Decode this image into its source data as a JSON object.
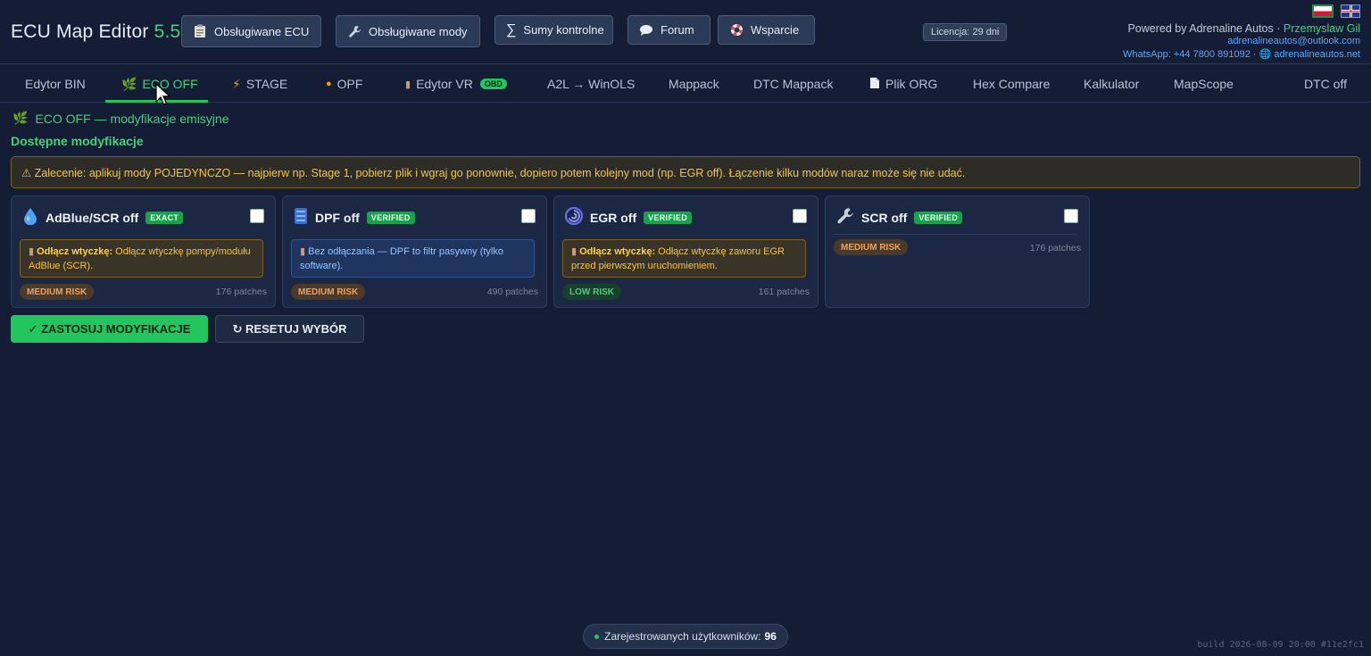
{
  "header": {
    "app_name": "ECU Map Editor",
    "version": "5.5",
    "buttons": [
      {
        "label": "Obsługiwane ECU",
        "icon": "clipboard-icon"
      },
      {
        "label": "Obsługiwane mody",
        "icon": "wrench-icon"
      },
      {
        "label": "Sumy kontrolne",
        "icon": "sigma-icon"
      },
      {
        "label": "Forum",
        "icon": "chat-bubble-icon"
      },
      {
        "label": "Wsparcie",
        "icon": "lifebuoy-icon"
      }
    ],
    "licence": "Licencja: 29 dni",
    "powered_prefix": "Powered by Adrenaline Autos ·",
    "powered_name": "Przemyslaw Gil",
    "email": "adrenalineautos@outlook.com",
    "whatsapp": "WhatsApp: +44 7800 891092 ·",
    "website": "adrenalineautos.net"
  },
  "tabs": [
    {
      "label": "Edytor BIN",
      "icon": ""
    },
    {
      "label": "ECO OFF",
      "icon": "leaf-icon",
      "active": true
    },
    {
      "label": "STAGE",
      "icon": "bolt-icon"
    },
    {
      "label": "OPF",
      "icon": "drop-icon"
    },
    {
      "label": "Edytor VR",
      "icon": "plug-icon",
      "badge": "OBD"
    },
    {
      "label": "A2L → WinOLS",
      "icon": ""
    },
    {
      "label": "Mappack",
      "icon": ""
    },
    {
      "label": "DTC Mappack",
      "icon": ""
    },
    {
      "label": "Plik ORG",
      "icon": "page-icon"
    },
    {
      "label": "Hex Compare",
      "icon": ""
    },
    {
      "label": "Kalkulator",
      "icon": ""
    },
    {
      "label": "MapScope",
      "icon": ""
    },
    {
      "label": "DTC off",
      "icon": ""
    }
  ],
  "section": {
    "title": "ECO OFF — modyfikacje emisyjne",
    "subtitle": "Dostępne modyfikacje",
    "warning": "⚠ Zalecenie: aplikuj mody POJEDYNCZO — najpierw np. Stage 1, pobierz plik i wgraj go ponownie, dopiero potem kolejny mod (np. EGR off). Łączenie kilku modów naraz może się nie udać."
  },
  "mods": [
    {
      "title": "AdBlue/SCR off",
      "tag": "EXACT",
      "icon": "water-drop-icon",
      "note_bold": "Odłącz wtyczkę:",
      "note_text": "Odłącz wtyczkę pompy/modułu AdBlue (SCR).",
      "note_style": "amber",
      "risk": "MEDIUM RISK",
      "risk_level": "medium",
      "patches": "176 patches"
    },
    {
      "title": "DPF off",
      "tag": "VERIFIED",
      "icon": "filter-icon",
      "note_bold": "",
      "note_text": "Bez odłączania — DPF to filtr pasywny (tylko software).",
      "note_style": "blue",
      "risk": "MEDIUM RISK",
      "risk_level": "medium",
      "patches": "490 patches"
    },
    {
      "title": "EGR off",
      "tag": "VERIFIED",
      "icon": "swirl-icon",
      "note_bold": "Odłącz wtyczkę:",
      "note_text": "Odłącz wtyczkę zaworu EGR przed pierwszym uruchomieniem.",
      "note_style": "amber",
      "risk": "LOW RISK",
      "risk_level": "low",
      "patches": "161 patches"
    },
    {
      "title": "SCR off",
      "tag": "VERIFIED",
      "icon": "wrench-icon",
      "note_bold": "",
      "note_text": "",
      "note_style": "none",
      "risk": "MEDIUM RISK",
      "risk_level": "medium",
      "patches": "176 patches"
    }
  ],
  "actions": {
    "apply": "✓ ZASTOSUJ MODYFIKACJE",
    "reset": "↻ RESETUJ WYBÓR"
  },
  "footer": {
    "users_label": "Zarejestrowanych użytkowników:",
    "users_count": "96",
    "build": "build 2026-08-09 20:00 #11e2fc1"
  },
  "colors": {
    "background": "#141d35",
    "accent_green": "#22c55e",
    "warning_amber": "#f5c542",
    "link_blue": "#5ea6ff"
  }
}
